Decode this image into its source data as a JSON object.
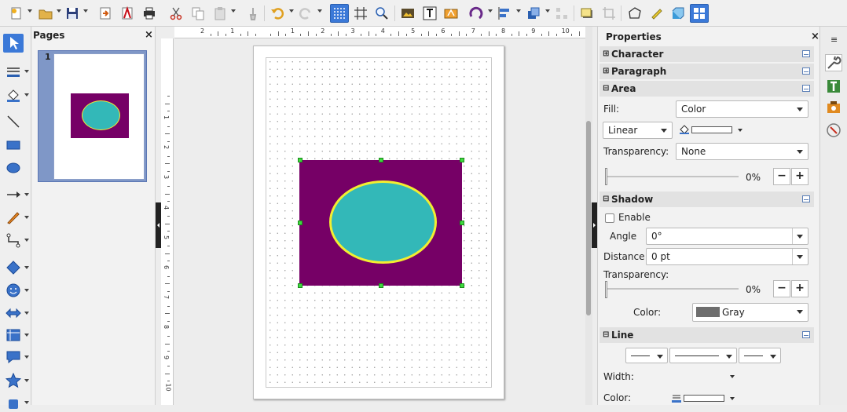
{
  "toolbar": {
    "icons": [
      "new-document",
      "open-folder",
      "save",
      "export",
      "export-pdf",
      "print",
      "cut",
      "copy",
      "paste",
      "clone-formatting",
      "undo",
      "redo",
      "grid",
      "helplines",
      "zoom",
      "image",
      "text",
      "fontwork",
      "transformations",
      "align",
      "arrange",
      "distribute",
      "shadow",
      "crop",
      "points",
      "glue",
      "toggle-extrusion",
      "display-views"
    ]
  },
  "pages_panel": {
    "title": "Pages",
    "close": "×",
    "slide_number": "1"
  },
  "ruler": {
    "h_ticks": [
      "2",
      "1",
      "",
      "1",
      "2",
      "3",
      "4",
      "5",
      "6",
      "7",
      "8",
      "9",
      "10"
    ],
    "v_ticks": [
      "1",
      "2",
      "3",
      "4",
      "5",
      "6",
      "7",
      "8",
      "9",
      "10"
    ]
  },
  "shape": {
    "rect_color": "#760066",
    "ellipse_fill": "#33b8b8",
    "ellipse_border": "#f2ee30"
  },
  "properties": {
    "title": "Properties",
    "close": "×",
    "sections": {
      "character": {
        "toggle": "⊞",
        "label": "Character"
      },
      "paragraph": {
        "toggle": "⊞",
        "label": "Paragraph"
      },
      "area": {
        "toggle": "⊟",
        "label": "Area"
      },
      "shadow": {
        "toggle": "⊟",
        "label": "Shadow"
      },
      "line": {
        "toggle": "⊟",
        "label": "Line"
      }
    },
    "area": {
      "fill_label": "Fill:",
      "fill_value": "Color",
      "gradient_value": "Linear",
      "transparency_label": "Transparency:",
      "transparency_value": "None",
      "transparency_percent": "0%",
      "minus": "−",
      "plus": "+"
    },
    "shadow": {
      "enable_label": "Enable",
      "enabled": false,
      "angle_label": "Angle",
      "angle_value": "0°",
      "distance_label": "Distance",
      "distance_value": "0 pt",
      "transparency_label": "Transparency:",
      "transparency_percent": "0%",
      "minus": "−",
      "plus": "+",
      "color_label": "Color:",
      "color_value": "Gray",
      "color_swatch": "#6e6e6e"
    },
    "line": {
      "width_label": "Width:",
      "color_label": "Color:"
    }
  }
}
